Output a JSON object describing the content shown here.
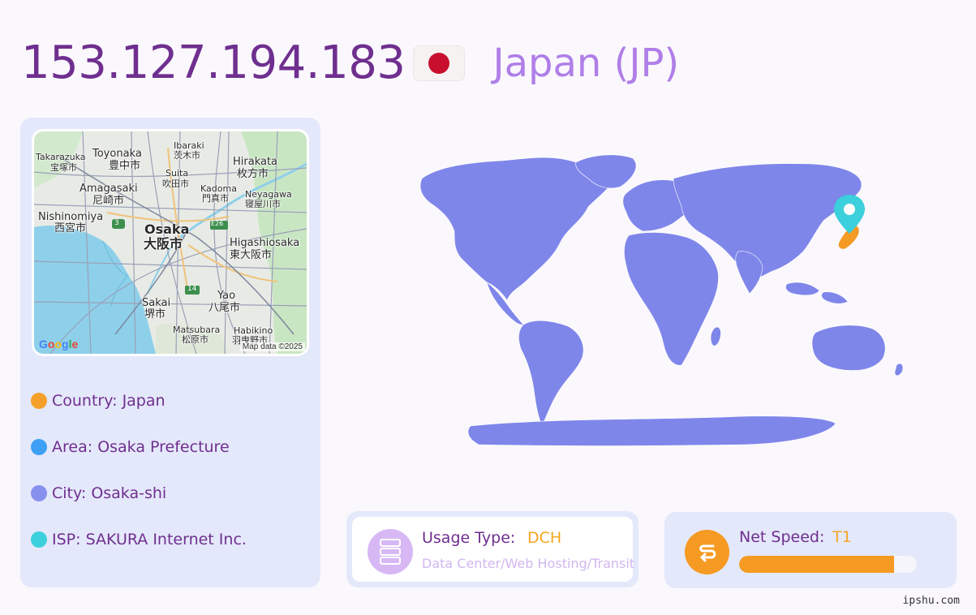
{
  "header": {
    "ip": "153.127.194.183",
    "flag_icon": "japan-flag-icon",
    "country": "Japan (JP)"
  },
  "mini_map": {
    "labels": [
      {
        "text": "Takarazuka",
        "size": "sm"
      },
      {
        "text": "宝塚市",
        "size": "sm"
      },
      {
        "text": "Toyonaka",
        "size": "mid"
      },
      {
        "text": "豊中市",
        "size": "mid"
      },
      {
        "text": "Ibaraki",
        "size": "sm"
      },
      {
        "text": "茨木市",
        "size": "sm"
      },
      {
        "text": "Hirakata",
        "size": "mid"
      },
      {
        "text": "枚方市",
        "size": "mid"
      },
      {
        "text": "Suita",
        "size": "sm"
      },
      {
        "text": "吹田市",
        "size": "sm"
      },
      {
        "text": "Amagasaki",
        "size": "mid"
      },
      {
        "text": "尼崎市",
        "size": "mid"
      },
      {
        "text": "Kadoma",
        "size": "sm"
      },
      {
        "text": "門真市",
        "size": "sm"
      },
      {
        "text": "Neyagawa",
        "size": "sm"
      },
      {
        "text": "寝屋川市",
        "size": "sm"
      },
      {
        "text": "Nishinomiya",
        "size": "mid"
      },
      {
        "text": "西宮市",
        "size": "mid"
      },
      {
        "text": "Osaka",
        "size": "big"
      },
      {
        "text": "大阪市",
        "size": "big"
      },
      {
        "text": "Higashiosaka",
        "size": "mid"
      },
      {
        "text": "東大阪市",
        "size": "mid"
      },
      {
        "text": "Yao",
        "size": "mid"
      },
      {
        "text": "八尾市",
        "size": "mid"
      },
      {
        "text": "Sakai",
        "size": "mid"
      },
      {
        "text": "堺市",
        "size": "mid"
      },
      {
        "text": "Matsubara",
        "size": "sm"
      },
      {
        "text": "松原市",
        "size": "sm"
      },
      {
        "text": "Habikino",
        "size": "sm"
      },
      {
        "text": "羽曳野市",
        "size": "sm"
      }
    ],
    "road_badges": [
      "3",
      "E26",
      "14"
    ],
    "logo": "Google",
    "credit": "Map data ©2025"
  },
  "info": [
    {
      "key": "Country",
      "value": "Japan",
      "color": "#f5a02a"
    },
    {
      "key": "Area",
      "value": "Osaka Prefecture",
      "color": "#3ea0f5"
    },
    {
      "key": "City",
      "value": "Osaka-shi",
      "color": "#8890ee"
    },
    {
      "key": "ISP",
      "value": "SAKURA Internet Inc.",
      "color": "#3cd0dc"
    }
  ],
  "world_map": {
    "land_color": "#7f86ea",
    "highlight_color": "#f59a23",
    "pin_color": "#3ccfdc",
    "pin_icon": "location-pin-icon"
  },
  "usage": {
    "title": "Usage Type:",
    "value": "DCH",
    "description": "Data Center/Web Hosting/Transit",
    "icon": "server-icon"
  },
  "speed": {
    "title": "Net Speed:",
    "value": "T1",
    "level": 0.87,
    "icon": "speed-icon"
  },
  "footer": "ipshu.com"
}
